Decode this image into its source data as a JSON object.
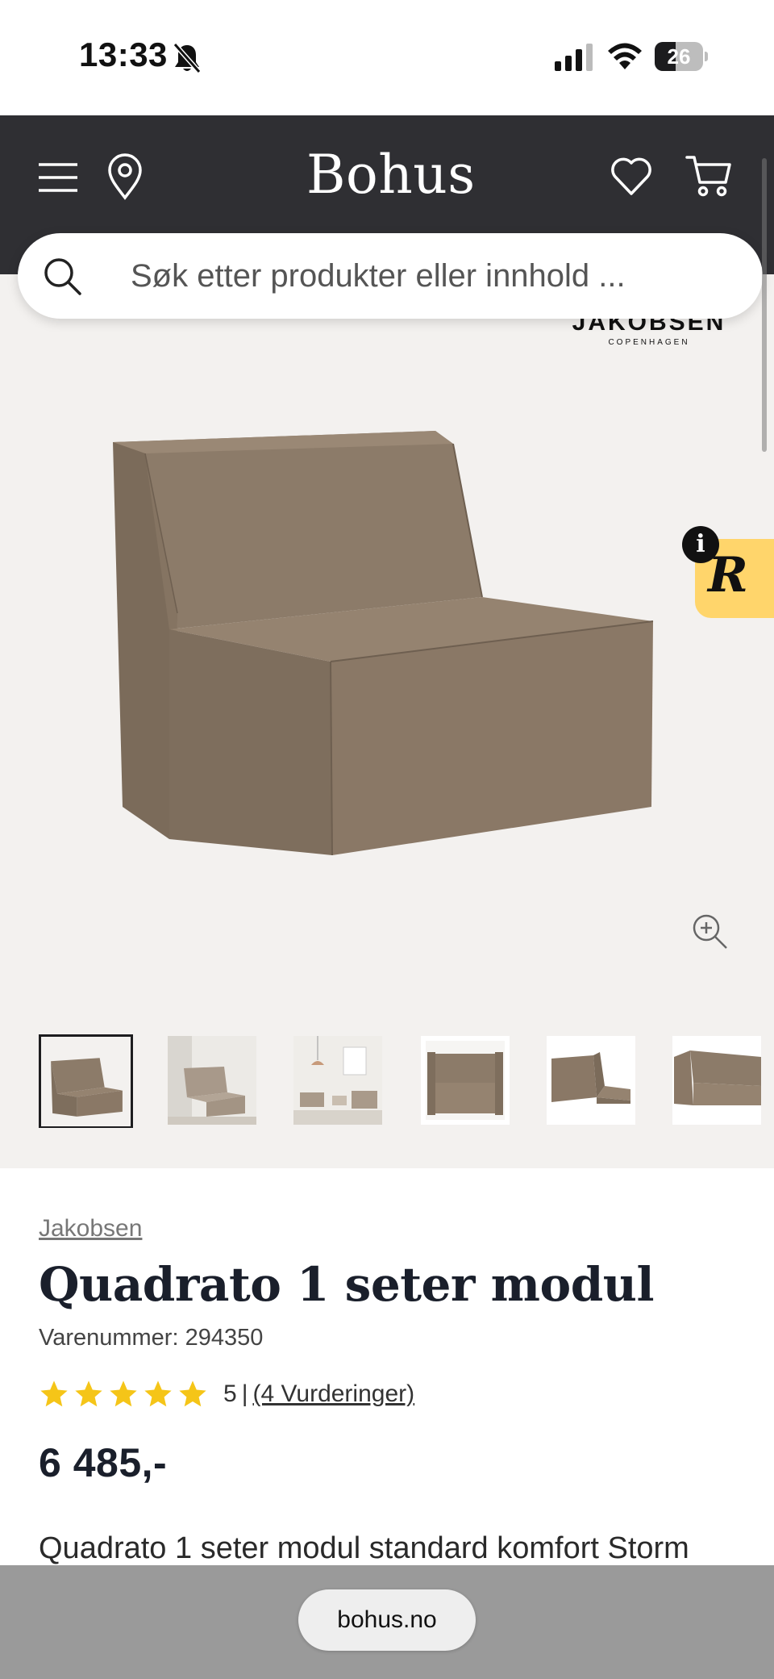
{
  "status_bar": {
    "time": "13:33",
    "battery_level": "26",
    "icons": [
      "bell-off-icon",
      "cellular-signal-icon",
      "wifi-icon",
      "battery-icon"
    ]
  },
  "header": {
    "logo": "Bohus",
    "background_color": "#2f2f33",
    "icons": [
      "menu-icon",
      "location-pin-icon",
      "heart-icon",
      "cart-icon"
    ]
  },
  "search": {
    "placeholder": "Søk etter produkter eller innhold ..."
  },
  "gallery": {
    "brand_logo_main": "JAKOBSEN",
    "brand_logo_sub": "COPENHAGEN",
    "thumbnail_count": 6,
    "active_thumbnail": 1,
    "badge_letter": "R",
    "badge_info": "i",
    "background_color": "#f3f1ef",
    "sofa_color": "#8b7a68"
  },
  "product": {
    "brand": "Jakobsen",
    "title": "Quadrato 1 seter modul",
    "sku_label": "Varenummer: 294350",
    "rating_value": 5,
    "rating_score": "5",
    "rating_separator": "|",
    "rating_count_label": "(4 Vurderinger)",
    "price": "6 485,-",
    "description": "Quadrato 1 seter modul standard komfort Storm",
    "star_color": "#f5c518"
  },
  "browser": {
    "url": "bohus.no"
  }
}
